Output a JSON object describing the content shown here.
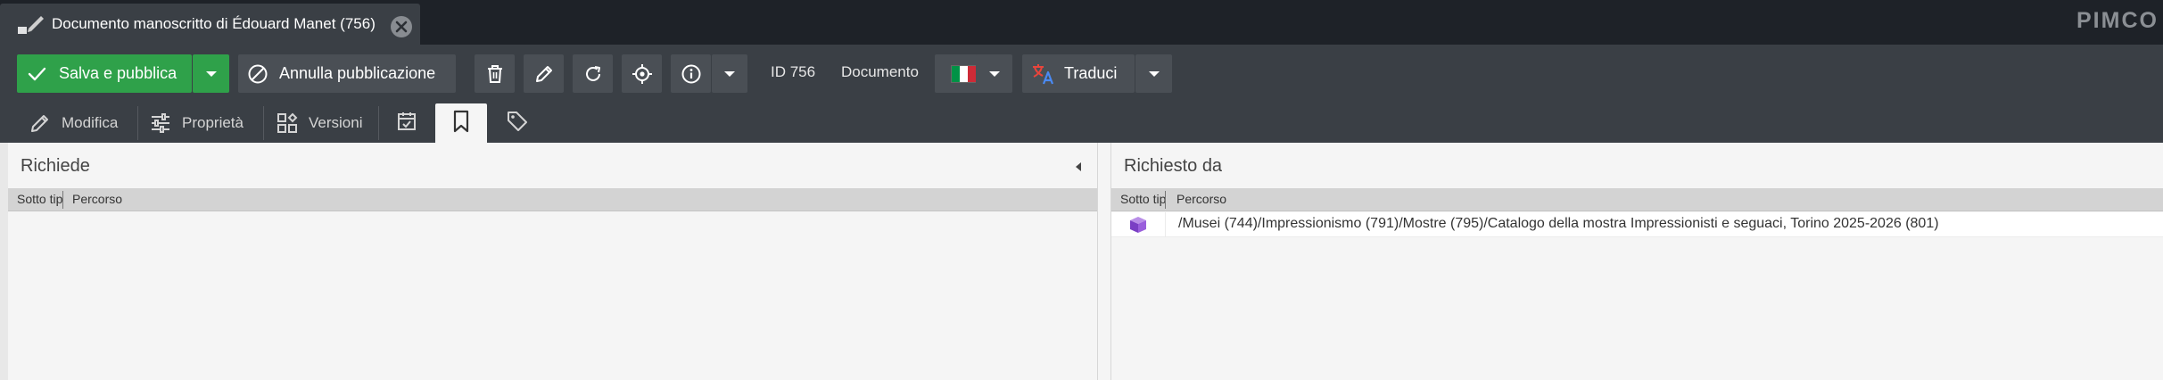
{
  "top_tab": {
    "title": "Documento manoscritto di Édouard Manet (756)",
    "icon": "edit-document-icon"
  },
  "brand": "PIMCO",
  "toolbar": {
    "publish_label": "Salva e pubblica",
    "unpublish_label": "Annulla pubblicazione",
    "id_label": "ID 756",
    "type_label": "Documento",
    "translate_label": "Traduci",
    "colors": {
      "publish": "#2fa14a",
      "button": "#4a4f55",
      "toolbar_bg": "#3a3f45",
      "topbar_bg": "#1e2228"
    }
  },
  "subtabs": [
    {
      "label": "Modifica",
      "icon": "pencil-icon"
    },
    {
      "label": "Proprietà",
      "icon": "sliders-icon"
    },
    {
      "label": "Versioni",
      "icon": "versions-icon"
    },
    {
      "label": "",
      "icon": "calendar-check-icon"
    },
    {
      "label": "",
      "icon": "bookmark-icon",
      "active": true
    },
    {
      "label": "",
      "icon": "tag-icon"
    }
  ],
  "left_panel": {
    "title": "Richiede",
    "columns": [
      "Sotto tipo",
      "Percorso"
    ],
    "rows": []
  },
  "right_panel": {
    "title": "Richiesto da",
    "columns": [
      "Sotto tipo",
      "Percorso"
    ],
    "rows": [
      {
        "icon": "data-object-icon",
        "path": "/Musei (744)/Impressionismo (791)/Mostre (795)/Catalogo della mostra Impressionisti e seguaci, Torino 2025-2026 (801)"
      }
    ]
  }
}
